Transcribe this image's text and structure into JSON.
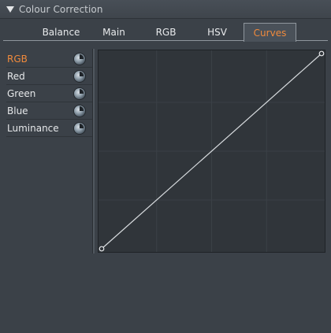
{
  "panel": {
    "title": "Colour Correction"
  },
  "tabs": [
    {
      "label": "Balance",
      "active": false
    },
    {
      "label": "Main",
      "active": false
    },
    {
      "label": "RGB",
      "active": false
    },
    {
      "label": "HSV",
      "active": false
    },
    {
      "label": "Curves",
      "active": true
    }
  ],
  "channels": [
    {
      "label": "RGB",
      "active": true,
      "icon": "reset-dial-icon"
    },
    {
      "label": "Red",
      "active": false,
      "icon": "reset-dial-icon"
    },
    {
      "label": "Green",
      "active": false,
      "icon": "reset-dial-icon"
    },
    {
      "label": "Blue",
      "active": false,
      "icon": "reset-dial-icon"
    },
    {
      "label": "Luminance",
      "active": false,
      "icon": "reset-dial-icon"
    }
  ],
  "curve": {
    "points": [
      [
        0,
        0
      ],
      [
        1,
        1
      ]
    ],
    "grid": true
  },
  "colors": {
    "accent": "#f08a3c",
    "panel_bg": "#3b4148",
    "curve_bg": "#30353a",
    "curve_line": "#d8dcdf"
  }
}
